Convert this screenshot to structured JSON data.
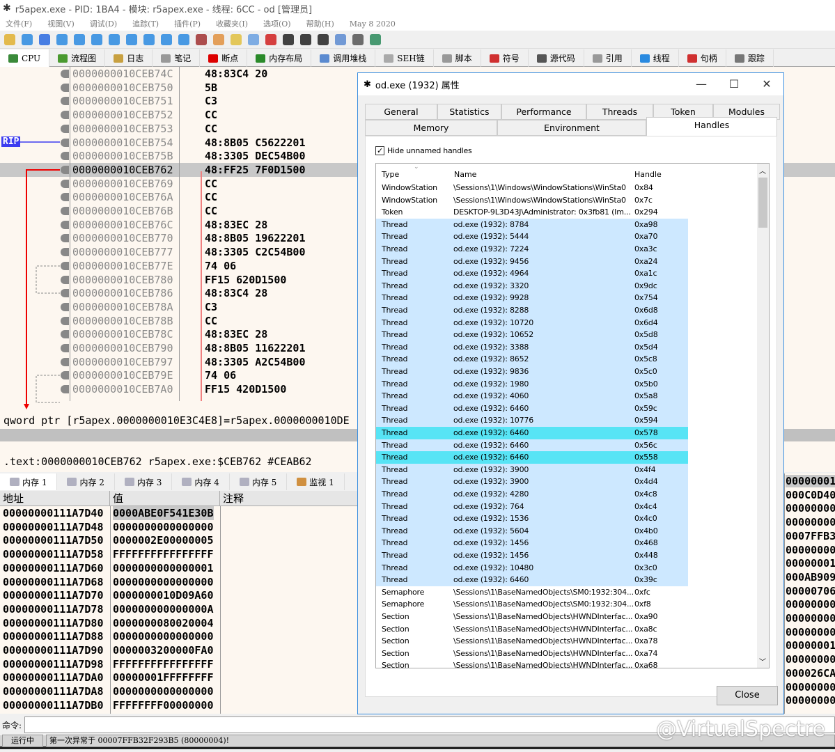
{
  "window": {
    "title": "r5apex.exe - PID: 1BA4 - 模块: r5apex.exe - 线程: 6CC - od [管理员]"
  },
  "menu": [
    "文件(F)",
    "视图(V)",
    "调试(D)",
    "追踪(T)",
    "插件(P)",
    "收藏夹(I)",
    "选项(O)",
    "帮助(H)",
    "May 8 2020"
  ],
  "toolbar_icons": [
    "open-icon",
    "restart-icon",
    "stop-icon",
    "run-icon",
    "pause-icon",
    "step-into-icon",
    "step-over-icon",
    "trace-into-icon",
    "trace-over-icon",
    "execute-till-return-icon",
    "run-to-user-code-icon",
    "scylla-icon",
    "patch-icon",
    "comment-icon",
    "link-icon",
    "tag-icon",
    "function-icon",
    "hash-icon",
    "font-icon",
    "device-icon",
    "calculator-icon",
    "globe-icon"
  ],
  "tabs": [
    {
      "label": "CPU",
      "icon": "cpu-icon",
      "color": "#3a8a3a"
    },
    {
      "label": "流程图",
      "icon": "tree-icon",
      "color": "#4a9a30"
    },
    {
      "label": "日志",
      "icon": "log-icon",
      "color": "#c8a040"
    },
    {
      "label": "笔记",
      "icon": "notes-icon",
      "color": "#999"
    },
    {
      "label": "断点",
      "icon": "breakpoint-icon",
      "color": "#d00"
    },
    {
      "label": "内存布局",
      "icon": "memory-map-icon",
      "color": "#2a8a2a"
    },
    {
      "label": "调用堆栈",
      "icon": "call-stack-icon",
      "color": "#5a8ad0"
    },
    {
      "label": "SEH链",
      "icon": "seh-icon",
      "color": "#aaa"
    },
    {
      "label": "脚本",
      "icon": "script-icon",
      "color": "#999"
    },
    {
      "label": "符号",
      "icon": "symbol-icon",
      "color": "#d03030"
    },
    {
      "label": "源代码",
      "icon": "source-icon",
      "color": "#555"
    },
    {
      "label": "引用",
      "icon": "search-icon",
      "color": "#999"
    },
    {
      "label": "线程",
      "icon": "thread-icon",
      "color": "#2a8ae0"
    },
    {
      "label": "句柄",
      "icon": "handles-icon",
      "color": "#d03030"
    },
    {
      "label": "跟踪",
      "icon": "trace-icon",
      "color": "#777"
    }
  ],
  "disasm": {
    "rip_label": "RIP",
    "rows": [
      [
        "0000000010CEB74C",
        "48:83C4 20"
      ],
      [
        "0000000010CEB750",
        "5B"
      ],
      [
        "0000000010CEB751",
        "C3"
      ],
      [
        "0000000010CEB752",
        "CC"
      ],
      [
        "0000000010CEB753",
        "CC"
      ],
      [
        "0000000010CEB754",
        "48:8B05 C5622201"
      ],
      [
        "0000000010CEB75B",
        "48:3305 DEC54B00"
      ],
      [
        "0000000010CEB762",
        "48:FF25 7F0D1500"
      ],
      [
        "0000000010CEB769",
        "CC"
      ],
      [
        "0000000010CEB76A",
        "CC"
      ],
      [
        "0000000010CEB76B",
        "CC"
      ],
      [
        "0000000010CEB76C",
        "48:83EC 28"
      ],
      [
        "0000000010CEB770",
        "48:8B05 19622201"
      ],
      [
        "0000000010CEB777",
        "48:3305 C2C54B00"
      ],
      [
        "0000000010CEB77E",
        "74 06"
      ],
      [
        "0000000010CEB780",
        "FF15 620D1500"
      ],
      [
        "0000000010CEB786",
        "48:83C4 28"
      ],
      [
        "0000000010CEB78A",
        "C3"
      ],
      [
        "0000000010CEB78B",
        "CC"
      ],
      [
        "0000000010CEB78C",
        "48:83EC 28"
      ],
      [
        "0000000010CEB790",
        "48:8B05 11622201"
      ],
      [
        "0000000010CEB797",
        "48:3305 A2C54B00"
      ],
      [
        "0000000010CEB79E",
        "74 06"
      ],
      [
        "0000000010CEB7A0",
        "FF15 420D1500"
      ]
    ],
    "selected_index": 7,
    "rip_index": 5
  },
  "info": {
    "line1": "qword ptr [r5apex.0000000010E3C4E8]=r5apex.0000000010DE",
    "line2": ".text:0000000010CEB762 r5apex.exe:$CEB762 #CEAB62"
  },
  "memtabs": [
    "内存 1",
    "内存 2",
    "内存 3",
    "内存 4",
    "内存 5",
    "监视 1"
  ],
  "memhdr": {
    "addr": "地址",
    "value": "值",
    "comment": "注释"
  },
  "memory": [
    [
      "00000000111A7D40",
      "0000ABE0F541E30B"
    ],
    [
      "00000000111A7D48",
      "0000000000000000"
    ],
    [
      "00000000111A7D50",
      "0000002E00000005"
    ],
    [
      "00000000111A7D58",
      "FFFFFFFFFFFFFFFF"
    ],
    [
      "00000000111A7D60",
      "0000000000000001"
    ],
    [
      "00000000111A7D68",
      "0000000000000000"
    ],
    [
      "00000000111A7D70",
      "0000000010D09A60"
    ],
    [
      "00000000111A7D78",
      "000000000000000A"
    ],
    [
      "00000000111A7D80",
      "0000000080020004"
    ],
    [
      "00000000111A7D88",
      "0000000000000000"
    ],
    [
      "00000000111A7D90",
      "0000003200000FA0"
    ],
    [
      "00000000111A7D98",
      "FFFFFFFFFFFFFFFF"
    ],
    [
      "00000000111A7DA0",
      "00000001FFFFFFFF"
    ],
    [
      "00000000111A7DA8",
      "0000000000000000"
    ],
    [
      "00000000111A7DB0",
      "FFFFFFFF00000000"
    ]
  ],
  "stack": [
    "00000001",
    "000C0D40",
    "00000000",
    "00000000",
    "0007FFB3",
    "00000000",
    "00000001",
    "000AB909",
    "00000706",
    "00000000",
    "00000000",
    "00000000",
    "00000001",
    "00000000",
    "000026CA",
    "00000000",
    "00000000"
  ],
  "command": {
    "label": "命令:",
    "value": ""
  },
  "status": {
    "state": "运行中",
    "message": "第一次异常于 00007FFB32F293B5 (80000004)!"
  },
  "watermark": "@VirtualSpectre",
  "dialog": {
    "title": "od.exe (1932) 属性",
    "tabs_row1": [
      "General",
      "Statistics",
      "Performance",
      "Threads",
      "Token",
      "Modules"
    ],
    "tabs_row2": [
      "Memory",
      "Environment",
      "Handles"
    ],
    "active_tab": "Handles",
    "hide_unnamed": {
      "label": "Hide unnamed handles",
      "checked": true
    },
    "columns": [
      "Type",
      "Name",
      "Handle"
    ],
    "rows": [
      [
        "WindowStation",
        "\\Sessions\\1\\Windows\\WindowStations\\WinSta0",
        "0x84"
      ],
      [
        "WindowStation",
        "\\Sessions\\1\\Windows\\WindowStations\\WinSta0",
        "0x7c"
      ],
      [
        "Token",
        "DESKTOP-9L3D43J\\Administrator: 0x3fb81 (Im...",
        "0x294"
      ],
      [
        "Thread",
        "od.exe (1932): 8784",
        "0xa98"
      ],
      [
        "Thread",
        "od.exe (1932): 5444",
        "0xa70"
      ],
      [
        "Thread",
        "od.exe (1932): 7224",
        "0xa3c"
      ],
      [
        "Thread",
        "od.exe (1932): 9456",
        "0xa24"
      ],
      [
        "Thread",
        "od.exe (1932): 4964",
        "0xa1c"
      ],
      [
        "Thread",
        "od.exe (1932): 3320",
        "0x9dc"
      ],
      [
        "Thread",
        "od.exe (1932): 9928",
        "0x754"
      ],
      [
        "Thread",
        "od.exe (1932): 8288",
        "0x6d8"
      ],
      [
        "Thread",
        "od.exe (1932): 10720",
        "0x6d4"
      ],
      [
        "Thread",
        "od.exe (1932): 10652",
        "0x5d8"
      ],
      [
        "Thread",
        "od.exe (1932): 3388",
        "0x5d4"
      ],
      [
        "Thread",
        "od.exe (1932): 8652",
        "0x5c8"
      ],
      [
        "Thread",
        "od.exe (1932): 9836",
        "0x5c0"
      ],
      [
        "Thread",
        "od.exe (1932): 1980",
        "0x5b0"
      ],
      [
        "Thread",
        "od.exe (1932): 4060",
        "0x5a8"
      ],
      [
        "Thread",
        "od.exe (1932): 6460",
        "0x59c"
      ],
      [
        "Thread",
        "od.exe (1932): 10776",
        "0x594"
      ],
      [
        "Thread",
        "od.exe (1932): 6460",
        "0x578"
      ],
      [
        "Thread",
        "od.exe (1932): 6460",
        "0x56c"
      ],
      [
        "Thread",
        "od.exe (1932): 6460",
        "0x558"
      ],
      [
        "Thread",
        "od.exe (1932): 3900",
        "0x4f4"
      ],
      [
        "Thread",
        "od.exe (1932): 3900",
        "0x4d4"
      ],
      [
        "Thread",
        "od.exe (1932): 4280",
        "0x4c8"
      ],
      [
        "Thread",
        "od.exe (1932): 764",
        "0x4c4"
      ],
      [
        "Thread",
        "od.exe (1932): 1536",
        "0x4c0"
      ],
      [
        "Thread",
        "od.exe (1932): 5604",
        "0x4b0"
      ],
      [
        "Thread",
        "od.exe (1932): 1456",
        "0x468"
      ],
      [
        "Thread",
        "od.exe (1932): 1456",
        "0x448"
      ],
      [
        "Thread",
        "od.exe (1932): 10480",
        "0x3c0"
      ],
      [
        "Thread",
        "od.exe (1932): 6460",
        "0x39c"
      ],
      [
        "Semaphore",
        "\\Sessions\\1\\BaseNamedObjects\\SM0:1932:304...",
        "0xfc"
      ],
      [
        "Semaphore",
        "\\Sessions\\1\\BaseNamedObjects\\SM0:1932:304...",
        "0xf8"
      ],
      [
        "Section",
        "\\Sessions\\1\\BaseNamedObjects\\HWNDInterfac...",
        "0xa90"
      ],
      [
        "Section",
        "\\Sessions\\1\\BaseNamedObjects\\HWNDInterfac...",
        "0xa8c"
      ],
      [
        "Section",
        "\\Sessions\\1\\BaseNamedObjects\\HWNDInterfac...",
        "0xa78"
      ],
      [
        "Section",
        "\\Sessions\\1\\BaseNamedObjects\\HWNDInterfac...",
        "0xa74"
      ],
      [
        "Section",
        "\\Sessions\\1\\BaseNamedObjects\\HWNDInterfac...",
        "0xa68"
      ]
    ],
    "highlighted_rows": [
      20,
      22
    ],
    "close_label": "Close",
    "colors": {
      "thread_row": "#cde8ff",
      "highlight_row": "#57e4f5"
    }
  }
}
